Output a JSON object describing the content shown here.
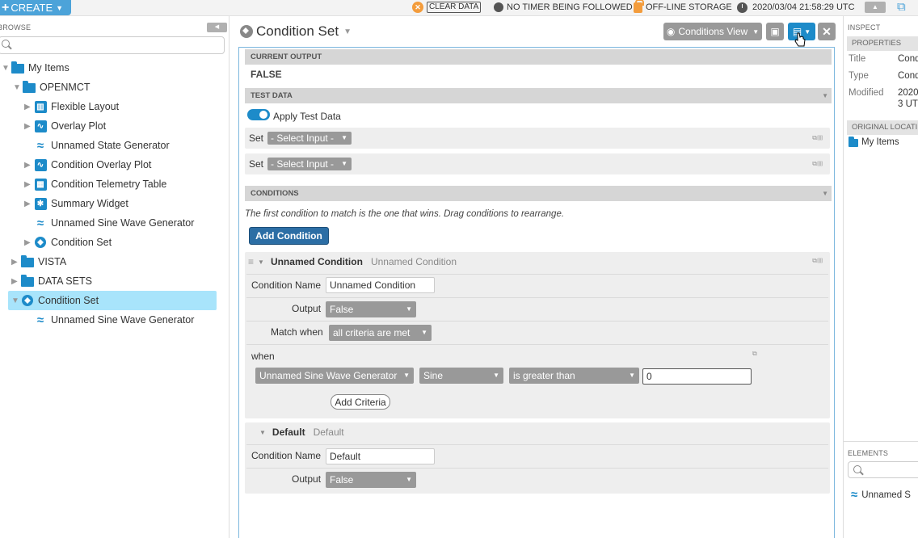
{
  "topbar": {
    "create_label": "CREATE",
    "clear_data_label": "CLEAR DATA",
    "timer_status": "NO TIMER BEING FOLLOWED",
    "storage_status": "OFF-LINE STORAGE",
    "datetime": "2020/03/04 21:58:29 UTC"
  },
  "browse": {
    "title": "BROWSE",
    "search_placeholder": "",
    "tree": [
      {
        "label": "My Items"
      },
      {
        "label": "OPENMCT"
      },
      {
        "label": "Flexible Layout"
      },
      {
        "label": "Overlay Plot"
      },
      {
        "label": "Unnamed State Generator"
      },
      {
        "label": "Condition Overlay Plot"
      },
      {
        "label": "Condition Telemetry Table"
      },
      {
        "label": "Summary Widget"
      },
      {
        "label": "Unnamed Sine Wave Generator"
      },
      {
        "label": "Condition Set"
      },
      {
        "label": "VISTA"
      },
      {
        "label": "DATA SETS"
      },
      {
        "label": "Condition Set"
      },
      {
        "label": "Unnamed Sine Wave Generator"
      }
    ]
  },
  "main": {
    "title": "Condition Set",
    "view_button": "Conditions View",
    "current_output": {
      "header": "CURRENT OUTPUT",
      "value": "FALSE"
    },
    "test_data": {
      "header": "TEST DATA",
      "apply_label": "Apply Test Data",
      "rows": [
        {
          "label": "Set",
          "select": "- Select Input -"
        },
        {
          "label": "Set",
          "select": "- Select Input -"
        }
      ]
    },
    "conditions": {
      "header": "CONDITIONS",
      "hint": "The first condition to match is the one that wins. Drag conditions to rearrange.",
      "add_condition": "Add Condition",
      "unnamed": {
        "name": "Unnamed Condition",
        "subtitle": "Unnamed Condition",
        "name_label": "Condition Name",
        "name_value": "Unnamed Condition",
        "output_label": "Output",
        "output_value": "False",
        "match_label": "Match when",
        "match_value": "all criteria are met",
        "when_label": "when",
        "telemetry": "Unnamed Sine Wave Generator",
        "metadata": "Sine",
        "operation": "is greater than",
        "input": "0",
        "add_criteria": "Add Criteria"
      },
      "default": {
        "name": "Default",
        "subtitle": "Default",
        "name_label": "Condition Name",
        "name_value": "Default",
        "output_label": "Output",
        "output_value": "False"
      }
    }
  },
  "inspect": {
    "title": "INSPECT",
    "properties_header": "PROPERTIES",
    "props": [
      {
        "k": "Title",
        "v": "Cond"
      },
      {
        "k": "Type",
        "v": "Cond"
      },
      {
        "k": "Modified",
        "v": "2020"
      },
      {
        "k": "",
        "v": "3 UT"
      }
    ],
    "original_location_header": "ORIGINAL LOCATI",
    "original_location": "My Items",
    "elements_title": "ELEMENTS",
    "elements": [
      {
        "label": "Unnamed S"
      }
    ]
  }
}
